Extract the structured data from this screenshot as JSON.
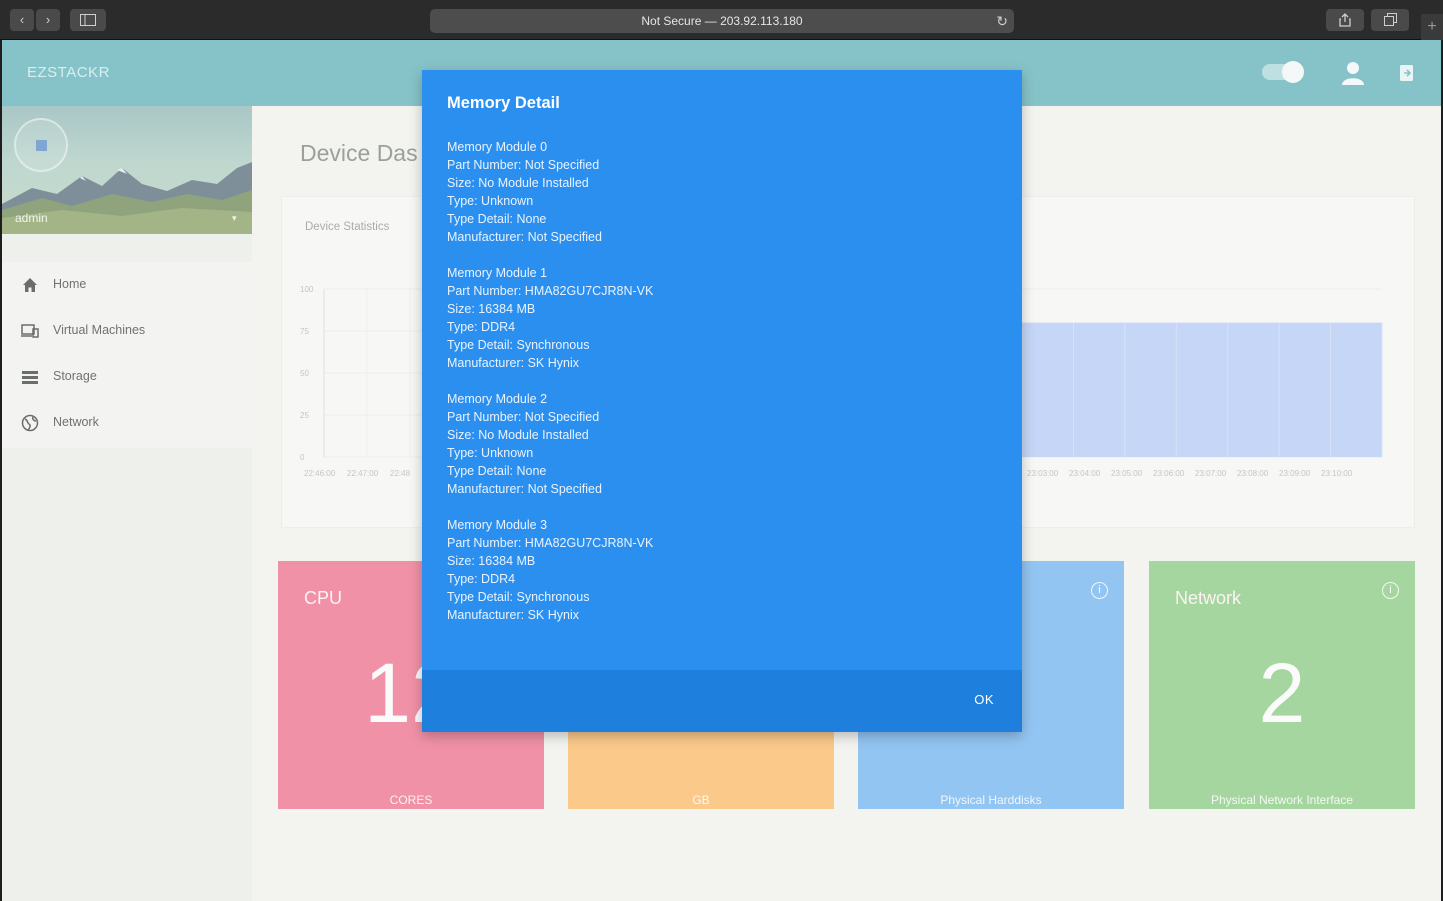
{
  "browser": {
    "url_text": "Not Secure — 203.92.113.180",
    "back_glyph": "‹",
    "forward_glyph": "›",
    "reload_glyph": "↻",
    "new_tab_glyph": "+",
    "icons": [
      "back-icon",
      "forward-icon",
      "sidebar-toggle-icon",
      "reload-icon",
      "share-icon",
      "tabs-icon",
      "new-tab-icon"
    ]
  },
  "header": {
    "brand": "EZSTACKR",
    "icons": [
      "theme-toggle",
      "user-icon",
      "logout-icon"
    ]
  },
  "sidebar": {
    "user_name": "admin",
    "caret": "▾",
    "items": [
      {
        "label": "Home",
        "icon": "home-icon"
      },
      {
        "label": "Virtual Machines",
        "icon": "virtual-machines-icon"
      },
      {
        "label": "Storage",
        "icon": "storage-icon"
      },
      {
        "label": "Network",
        "icon": "globe-icon"
      }
    ]
  },
  "main": {
    "title": "Device Das",
    "stats_title": "Device Statistics"
  },
  "chart_data": {
    "type": "area",
    "title": "Device Statistics",
    "y_ticks": [
      "100",
      "75",
      "50",
      "25",
      "0"
    ],
    "ylim": [
      0,
      100
    ],
    "x_labels_left": [
      "22:46:00",
      "22:47:00",
      "22:48"
    ],
    "x_labels_right": [
      "23:03:00",
      "23:04:00",
      "23:05:00",
      "23:06:00",
      "23:07:00",
      "23:08:00",
      "23:09:00",
      "23:10:00"
    ],
    "series": [
      {
        "values_visible_right": [
          80,
          80,
          80,
          80,
          80,
          80,
          80,
          80
        ],
        "color": "#c5d6f6"
      }
    ],
    "grid": true
  },
  "tiles": [
    {
      "title": "CPU",
      "value": "12",
      "footer": "CORES",
      "color": "#f091a7",
      "show_info": false
    },
    {
      "title": "",
      "value": "",
      "footer": "GB",
      "color": "#fbc98a",
      "show_info": false
    },
    {
      "title": "",
      "value": "",
      "footer": "Physical Harddisks",
      "color": "#93c5f3",
      "show_info": true
    },
    {
      "title": "Network",
      "value": "2",
      "footer": "Physical Network Interface",
      "color": "#a6d6a0",
      "show_info": true
    }
  ],
  "info_glyph": "i",
  "modal": {
    "title": "Memory Detail",
    "modules": [
      [
        "Memory Module 0",
        "Part Number: Not Specified",
        "Size: No Module Installed",
        "Type: Unknown",
        "Type Detail: None",
        "Manufacturer: Not Specified"
      ],
      [
        "Memory Module 1",
        "Part Number: HMA82GU7CJR8N-VK",
        "Size: 16384 MB",
        "Type: DDR4",
        "Type Detail: Synchronous",
        "Manufacturer: SK Hynix"
      ],
      [
        "Memory Module 2",
        "Part Number: Not Specified",
        "Size: No Module Installed",
        "Type: Unknown",
        "Type Detail: None",
        "Manufacturer: Not Specified"
      ],
      [
        "Memory Module 3",
        "Part Number: HMA82GU7CJR8N-VK",
        "Size: 16384 MB",
        "Type: DDR4",
        "Type Detail: Synchronous",
        "Manufacturer: SK Hynix"
      ]
    ],
    "ok_label": "OK"
  }
}
